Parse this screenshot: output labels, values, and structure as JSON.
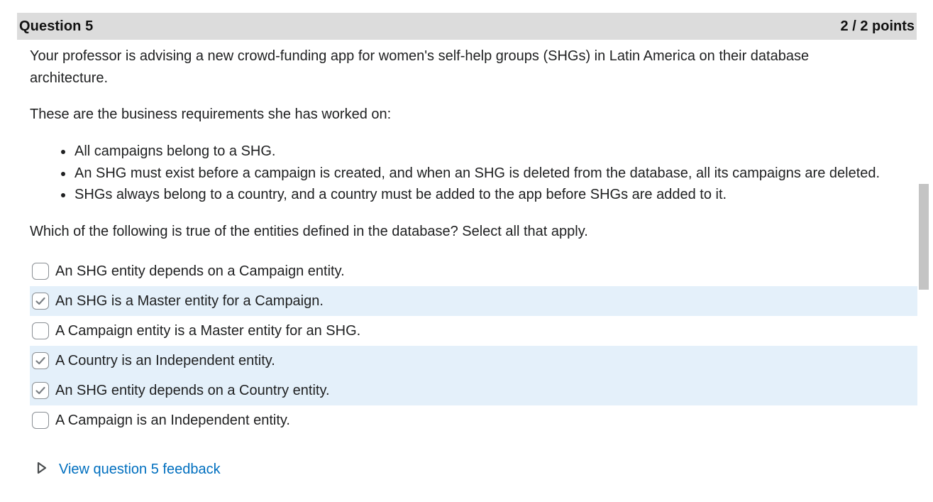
{
  "question": {
    "title": "Question 5",
    "points": "2 / 2 points"
  },
  "body": {
    "intro": "Your professor is advising a new crowd-funding app for women's self-help groups (SHGs) in Latin America on their database architecture.",
    "requirements_heading": "These are the business requirements she has worked on:",
    "requirements": [
      "All campaigns belong to a SHG.",
      "An SHG must exist before a campaign is created, and when an SHG is deleted from the database, all its campaigns are deleted.",
      "SHGs always belong to a country, and a country must be added to the app before SHGs are added to it."
    ],
    "prompt": "Which of the following is true of the entities defined in the database? Select all that apply."
  },
  "options": [
    {
      "label": "An SHG entity depends on a Campaign entity.",
      "checked": false
    },
    {
      "label": "An SHG is a Master entity for a Campaign.",
      "checked": true
    },
    {
      "label": "A Campaign entity is a Master entity for an SHG.",
      "checked": false
    },
    {
      "label": "A Country is an Independent entity.",
      "checked": true
    },
    {
      "label": "An SHG entity depends on a Country entity.",
      "checked": true
    },
    {
      "label": "A Campaign is an Independent entity.",
      "checked": false
    }
  ],
  "feedback": {
    "link_text": "View question 5 feedback",
    "icon": "triangle-right-icon"
  },
  "colors": {
    "header_bg": "#dcdcdc",
    "selected_row_bg": "#e4f0fa",
    "link": "#006fbf",
    "checkmark": "#7a7f84"
  }
}
